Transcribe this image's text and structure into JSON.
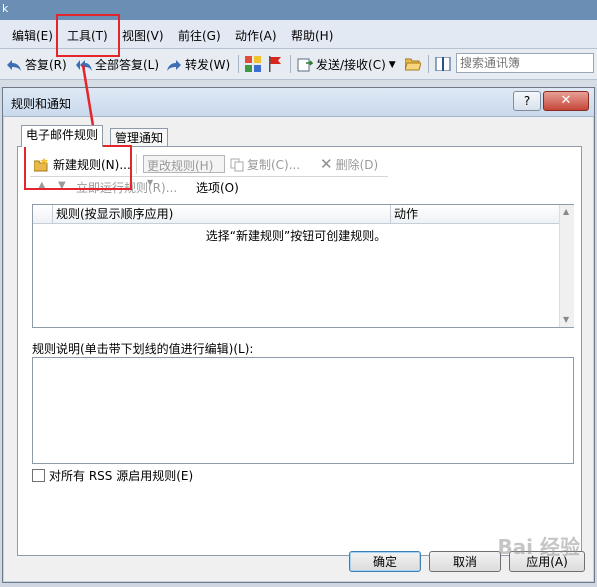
{
  "title_strip": {
    "char": "k"
  },
  "menu": {
    "edit": "编辑(E)",
    "tools": "工具(T)",
    "view": "视图(V)",
    "go": "前往(G)",
    "actions": "动作(A)",
    "help": "帮助(H)"
  },
  "toolbar": {
    "reply": "答复(R)",
    "reply_all": "全部答复(L)",
    "forward": "转发(W)",
    "send_receive": "发送/接收(C)",
    "search_placeholder": "搜索通讯簿"
  },
  "dialog": {
    "title": "规则和通知",
    "help": "?",
    "close": "✕",
    "tabs": {
      "email_rules": "电子邮件规则",
      "manage_alerts": "管理通知"
    },
    "panel_toolbar": {
      "new_rule": "新建规则(N)...",
      "change_rule": "更改规则(H)",
      "copy": "复制(C)...",
      "delete": "删除(D)",
      "run_now": "立即运行规则(R)...",
      "options": "选项(O)"
    },
    "rules_table": {
      "col_rule": "规则(按显示顺序应用)",
      "col_action": "动作",
      "empty_message": "选择“新建规则”按钮可创建规则。"
    },
    "description_label": "规则说明(单击带下划线的值进行编辑)(L):",
    "rss_checkbox_label": "对所有 RSS 源启用规则(E)",
    "buttons": {
      "ok": "确定",
      "cancel": "取消",
      "apply": "应用(A)"
    }
  },
  "watermark": "Bai 经验",
  "colors": {
    "annotation_red": "#e2262b",
    "menu_bg": "#e3e9f2"
  }
}
